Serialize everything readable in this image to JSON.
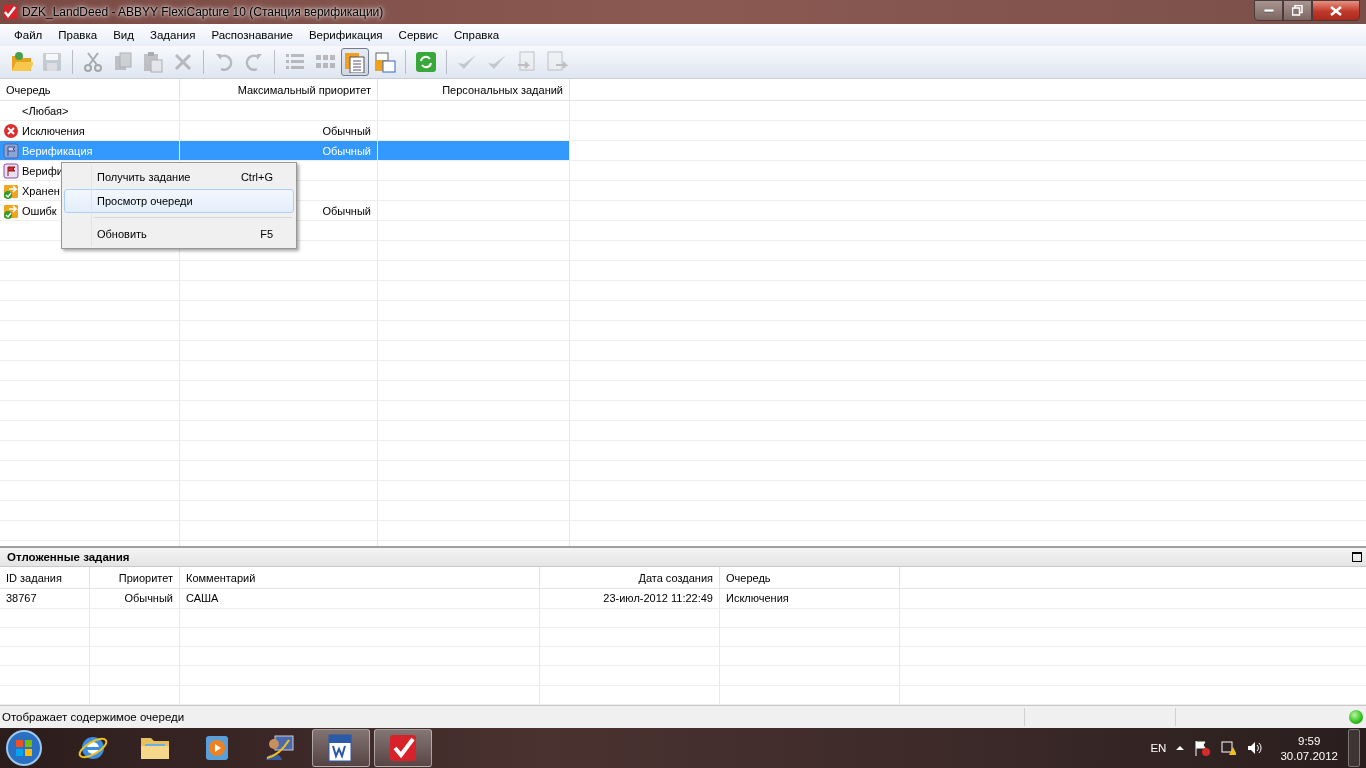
{
  "window": {
    "title": "DZK_LandDeed - ABBYY FlexiCapture 10 (Станция верификации)"
  },
  "menu": [
    "Файл",
    "Правка",
    "Вид",
    "Задания",
    "Распознавание",
    "Верификация",
    "Сервис",
    "Справка"
  ],
  "toolbar": [
    {
      "kind": "button",
      "disabled": false,
      "pressed": false
    },
    {
      "kind": "button",
      "disabled": true,
      "pressed": false
    },
    {
      "kind": "separator"
    },
    {
      "kind": "button",
      "disabled": true,
      "pressed": false
    },
    {
      "kind": "button",
      "disabled": true,
      "pressed": false
    },
    {
      "kind": "button",
      "disabled": true,
      "pressed": false
    },
    {
      "kind": "button",
      "disabled": true,
      "pressed": false
    },
    {
      "kind": "separator"
    },
    {
      "kind": "button",
      "disabled": true,
      "pressed": false
    },
    {
      "kind": "button",
      "disabled": true,
      "pressed": false
    },
    {
      "kind": "separator"
    },
    {
      "kind": "button",
      "disabled": true,
      "pressed": false
    },
    {
      "kind": "button",
      "disabled": true,
      "pressed": false
    },
    {
      "kind": "button",
      "disabled": false,
      "pressed": true
    },
    {
      "kind": "button",
      "disabled": false,
      "pressed": false
    },
    {
      "kind": "separator"
    },
    {
      "kind": "button",
      "disabled": false,
      "pressed": false
    },
    {
      "kind": "separator"
    },
    {
      "kind": "button",
      "disabled": true,
      "pressed": false
    },
    {
      "kind": "button",
      "disabled": true,
      "pressed": false
    },
    {
      "kind": "button",
      "disabled": true,
      "pressed": false
    },
    {
      "kind": "button",
      "disabled": true,
      "pressed": false
    }
  ],
  "queues": {
    "columns": [
      "Очередь",
      "Максимальный приоритет",
      "Персональных заданий"
    ],
    "rows": [
      {
        "name": "<Любая>",
        "selected": false
      },
      {
        "name": "Исключения",
        "priority": "Обычный",
        "selected": false
      },
      {
        "name": "Верификация",
        "priority": "Обычный",
        "selected": true
      },
      {
        "name": "Верифи",
        "selected": false
      },
      {
        "name": "Хранен",
        "selected": false
      },
      {
        "name": "Ошибк",
        "priority": "Обычный",
        "selected": false
      }
    ]
  },
  "context_menu": [
    {
      "kind": "item",
      "label": "Получить задание",
      "shortcut": "Ctrl+G",
      "selected": false
    },
    {
      "kind": "item",
      "label": "Просмотр очереди",
      "selected": true
    },
    {
      "kind": "separator"
    },
    {
      "kind": "item",
      "label": "Обновить",
      "shortcut": "F5",
      "selected": false
    }
  ],
  "postponed": {
    "title": "Отложенные задания",
    "columns": [
      "ID задания",
      "Приоритет",
      "Комментарий",
      "Дата создания",
      "Очередь"
    ],
    "rows": [
      [
        "38767",
        "Обычный",
        "САША",
        "23-июл-2012 11:22:49",
        "Исключения"
      ]
    ]
  },
  "status_bar": {
    "text": "Отображает содержимое очереди"
  },
  "taskbar": {
    "apps": [
      {
        "active": false
      },
      {
        "active": false
      },
      {
        "active": false
      },
      {
        "active": false
      },
      {
        "active": true
      },
      {
        "active": true
      }
    ],
    "language": "EN",
    "time": "9:59",
    "date": "30.07.2012"
  }
}
